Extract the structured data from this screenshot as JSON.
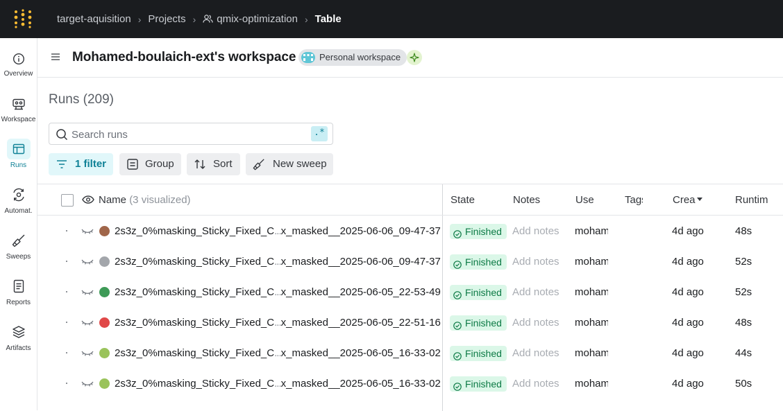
{
  "breadcrumb": {
    "items": [
      {
        "label": "target-aquisition"
      },
      {
        "label": "Projects"
      },
      {
        "label": "qmix-optimization",
        "icon": "users-icon"
      },
      {
        "label": "Table"
      }
    ]
  },
  "sidebar": {
    "items": [
      {
        "label": "Overview",
        "icon": "info-icon"
      },
      {
        "label": "Workspace",
        "icon": "robot-icon"
      },
      {
        "label": "Runs",
        "icon": "table-icon",
        "active": true
      },
      {
        "label": "Automat.",
        "icon": "automation-icon"
      },
      {
        "label": "Sweeps",
        "icon": "broom-icon"
      },
      {
        "label": "Reports",
        "icon": "report-icon"
      },
      {
        "label": "Artifacts",
        "icon": "layers-icon"
      }
    ]
  },
  "header": {
    "title": "Mohamed-boulaich-ext's workspace",
    "badge": "Personal workspace"
  },
  "runs": {
    "title": "Runs (209)",
    "search_placeholder": "Search runs",
    "regex_label": ".*"
  },
  "toolbar": {
    "filter_label": "1 filter",
    "group_label": "Group",
    "sort_label": "Sort",
    "sweep_label": "New sweep"
  },
  "table": {
    "columns": {
      "name": "Name",
      "name_note": "(3 visualized)",
      "state": "State",
      "notes": "Notes",
      "user": "Use",
      "tags": "Tags",
      "created": "Crea",
      "runtime": "Runtim"
    },
    "rows": [
      {
        "name_start": "2s3z_0%masking_Sticky_Fixed_C",
        "ellipsis": "...",
        "name_end": "x_masked__2025-06-06_09-47-37",
        "color": "#a0664a",
        "state": "Finished",
        "notes": "Add notes",
        "user": "moham",
        "created": "4d ago",
        "runtime": "48s"
      },
      {
        "name_start": "2s3z_0%masking_Sticky_Fixed_C",
        "ellipsis": "...",
        "name_end": "x_masked__2025-06-06_09-47-37",
        "color": "#a3a6ab",
        "state": "Finished",
        "notes": "Add notes",
        "user": "moham",
        "created": "4d ago",
        "runtime": "52s"
      },
      {
        "name_start": "2s3z_0%masking_Sticky_Fixed_C",
        "ellipsis": "...",
        "name_end": "x_masked__2025-06-05_22-53-49",
        "color": "#3e9a57",
        "state": "Finished",
        "notes": "Add notes",
        "user": "moham",
        "created": "4d ago",
        "runtime": "52s"
      },
      {
        "name_start": "2s3z_0%masking_Sticky_Fixed_C",
        "ellipsis": "...",
        "name_end": "x_masked__2025-06-05_22-51-16",
        "color": "#e04848",
        "state": "Finished",
        "notes": "Add notes",
        "user": "moham",
        "created": "4d ago",
        "runtime": "48s"
      },
      {
        "name_start": "2s3z_0%masking_Sticky_Fixed_C",
        "ellipsis": "...",
        "name_end": "x_masked__2025-06-05_16-33-02",
        "color": "#9ac35b",
        "state": "Finished",
        "notes": "Add notes",
        "user": "moham",
        "created": "4d ago",
        "runtime": "44s"
      },
      {
        "name_start": "2s3z_0%masking_Sticky_Fixed_C",
        "ellipsis": "...",
        "name_end": "x_masked__2025-06-05_16-33-02",
        "color": "#9ac35b",
        "state": "Finished",
        "notes": "Add notes",
        "user": "moham",
        "created": "4d ago",
        "runtime": "50s"
      }
    ]
  },
  "colors": {
    "topbar": "#1a1c1f",
    "accent": "#0f8196",
    "accent_bg": "#e1f7fa",
    "logo": "#fcbc32",
    "finished_bg": "#dbf7e8",
    "finished_text": "#0c7a45"
  }
}
